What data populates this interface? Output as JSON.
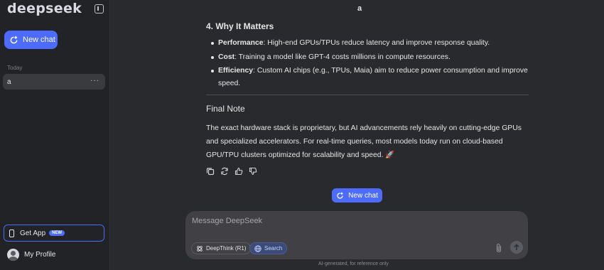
{
  "sidebar": {
    "logo": "deepseek",
    "new_chat_label": "New chat",
    "section_today": "Today",
    "conversations": [
      {
        "title": "a",
        "more": "···"
      }
    ],
    "get_app_label": "Get App",
    "get_app_badge": "NEW",
    "profile_label": "My Profile"
  },
  "header": {
    "title": "a"
  },
  "message": {
    "heading": "4. Why It Matters",
    "bullets": [
      {
        "term": "Performance",
        "text": ": High-end GPUs/TPUs reduce latency and improve response quality."
      },
      {
        "term": "Cost",
        "text": ": Training a model like GPT-4 costs millions in compute resources."
      },
      {
        "term": "Efficiency",
        "text": ": Custom AI chips (e.g., TPUs, Maia) aim to reduce power consumption and improve speed."
      }
    ],
    "final_heading": "Final Note",
    "final_text": "The exact hardware stack is proprietary, but AI advancements rely heavily on cutting-edge GPUs and specialized accelerators. For real-time queries, most models today run on cloud-based GPU/TPU clusters optimized for scalability and speed. 🚀"
  },
  "main": {
    "new_chat_label": "New chat"
  },
  "composer": {
    "placeholder": "Message DeepSeek",
    "deepthink_label": "DeepThink (R1)",
    "search_label": "Search"
  },
  "footer": {
    "disclaimer": "AI-generated, for reference only"
  },
  "colors": {
    "accent": "#4d6bfe",
    "background": "#292a2d",
    "sidebar": "#212327"
  }
}
